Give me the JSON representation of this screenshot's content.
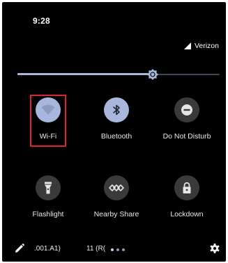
{
  "status_bar": {
    "time": "9:28",
    "carrier": "Verizon",
    "signal_icon": "signal-icon"
  },
  "brightness": {
    "level_percent": 67,
    "icon": "brightness-icon"
  },
  "tiles": [
    {
      "label": "Wi-Fi",
      "icon": "wifi-icon",
      "active": true,
      "highlighted": true
    },
    {
      "label": "Bluetooth",
      "icon": "bluetooth-icon",
      "active": true
    },
    {
      "label": "Do Not Disturb",
      "icon": "do-not-disturb-icon",
      "active": false
    },
    {
      "label": "Flashlight",
      "icon": "flashlight-icon",
      "active": false
    },
    {
      "label": "Nearby Share",
      "icon": "nearby-share-icon",
      "active": false
    },
    {
      "label": "Lockdown",
      "icon": "lock-icon",
      "active": false
    }
  ],
  "footer": {
    "build_left": ".001.A1)",
    "build_right": "11 (R(",
    "page_count": 3,
    "active_page": 0,
    "edit_icon": "pencil-icon",
    "settings_icon": "gear-icon"
  },
  "colors": {
    "background": "#000000",
    "accent": "#a8b8dc",
    "tile_off": "#3a3a3c",
    "highlight_border": "#d9262b"
  }
}
